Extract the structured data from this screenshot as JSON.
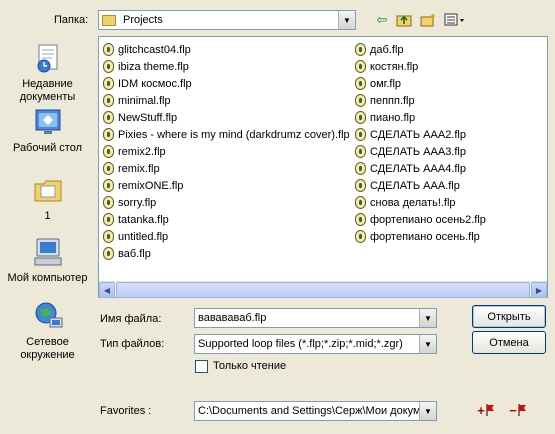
{
  "toolbar": {
    "folder_label": "Папка:",
    "current_folder": "Projects",
    "back_icon": "back-arrow-icon",
    "up_icon": "up-folder-icon",
    "new_folder_icon": "new-folder-icon",
    "views_icon": "views-menu-icon"
  },
  "places": [
    {
      "label": "Недавние документы",
      "icon": "recent-documents-icon"
    },
    {
      "label": "Рабочий стол",
      "icon": "desktop-icon"
    },
    {
      "label": "1",
      "icon": "my-documents-icon"
    },
    {
      "label": "Мой компьютер",
      "icon": "my-computer-icon"
    },
    {
      "label": "Сетевое окружение",
      "icon": "network-icon"
    }
  ],
  "files_col1": [
    "glitchcast04.flp",
    "ibiza theme.flp",
    "IDM космос.flp",
    "minimal.flp",
    "NewStuff.flp",
    "Pixies - where is my mind (darkdrumz cover).flp",
    "remix2.flp",
    "remix.flp",
    "remixONE.flp",
    "sorry.flp",
    "tatanka.flp",
    "untitled.flp",
    "ваб.flp"
  ],
  "files_col2": [
    "даб.flp",
    "костян.flp",
    "омг.flp",
    "пеппп.flp",
    "пиано.flp",
    "СДЕЛАТЬ ААА2.flp",
    "СДЕЛАТЬ ААА3.flp",
    "СДЕЛАТЬ ААА4.flp",
    "СДЕЛАТЬ ААА.flp",
    "снова делать!.flp",
    "фортепиано осень2.flp",
    "фортепиано осень.flp"
  ],
  "form": {
    "filename_label": "Имя файла:",
    "filename_value": "вавававаб.flp",
    "filetype_label": "Тип файлов:",
    "filetype_value": "Supported loop files (*.flp;*.zip;*.mid;*.zgr)",
    "readonly_label": "Только чтение",
    "favorites_label": "Favorites :",
    "favorites_value": "C:\\Documents and Settings\\Серж\\Мои докум"
  },
  "buttons": {
    "open": "Открыть",
    "cancel": "Отмена",
    "add_favorite": "+",
    "remove_favorite": "−"
  }
}
